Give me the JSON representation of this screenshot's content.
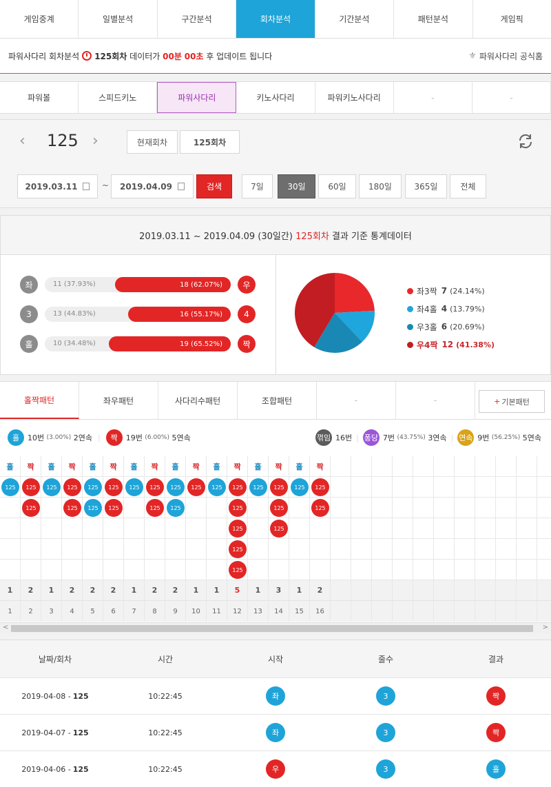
{
  "nav": [
    "게임중계",
    "일별분석",
    "구간분석",
    "회차분석",
    "기간분석",
    "패턴분석",
    "게임픽"
  ],
  "nav_active": 3,
  "info": {
    "prefix": "파워사다리 회차분석",
    "round": "125회차",
    "mid": "데이터가",
    "min": "00분",
    "sec": "00초",
    "suffix": "후 업데이트 됩니다",
    "homepage": "파워사다리 공식홈"
  },
  "game_tabs": [
    "파워볼",
    "스피드키노",
    "파워사다리",
    "키노사다리",
    "파워키노사다리",
    "-",
    "-"
  ],
  "game_tab_active": 2,
  "round_panel": {
    "round_number": "125",
    "current_label": "현재회차",
    "round_box": "125회차",
    "date_from": "2019.03.11",
    "date_to": "2019.04.09",
    "tilde": "~",
    "search": "검색",
    "ranges": [
      "7일",
      "30일",
      "60일",
      "180일",
      "365일",
      "전체"
    ],
    "range_active": 1
  },
  "stats": {
    "head_range": "2019.03.11 ~ 2019.04.09 (30일간)",
    "head_round": "125회차",
    "head_suffix": "결과 기준 통계데이터",
    "rows": [
      {
        "left_label": "좌",
        "left_val": "11 (37.93%)",
        "right_val": "18 (62.07%)",
        "right_label": "우",
        "right_pct": 62.07
      },
      {
        "left_label": "3",
        "left_val": "13 (44.83%)",
        "right_val": "16 (55.17%)",
        "right_label": "4",
        "right_pct": 55.17
      },
      {
        "left_label": "홀",
        "left_val": "10 (34.48%)",
        "right_val": "19 (65.52%)",
        "right_label": "짝",
        "right_pct": 65.52
      }
    ],
    "pie": [
      {
        "label": "좌3짝",
        "count": "7",
        "pct": "(24.14%)",
        "value": 24.14,
        "color": "#e8282b"
      },
      {
        "label": "좌4홀",
        "count": "4",
        "pct": "(13.79%)",
        "value": 13.79,
        "color": "#1fa6dc"
      },
      {
        "label": "우3홀",
        "count": "6",
        "pct": "(20.69%)",
        "value": 20.69,
        "color": "#1a88b4"
      },
      {
        "label": "우4짝",
        "count": "12",
        "pct": "(41.38%)",
        "value": 41.38,
        "color": "#c21d22"
      }
    ]
  },
  "pattern": {
    "tabs": [
      "홀짝패턴",
      "좌우패턴",
      "사다리수패턴",
      "조합패턴",
      "-",
      "-"
    ],
    "tab_active": 0,
    "basic_button": "기본패턴",
    "summary": {
      "odd_label": "홀",
      "odd_text": "10번",
      "odd_pct": "(3.00%)",
      "odd_streak": "2연속",
      "even_label": "짝",
      "even_text": "19번",
      "even_pct": "(6.00%)",
      "even_streak": "5연속",
      "break_label": "꺾임",
      "break_text": "16번",
      "pong_label": "퐁당",
      "pong_text": "7번",
      "pong_pct": "(43.75%)",
      "pong_streak": "3연속",
      "cont_label": "연속",
      "cont_text": "9번",
      "cont_pct": "(56.25%)",
      "cont_streak": "5연속"
    },
    "columns": [
      {
        "head": "홀",
        "type": "blue",
        "count": 1
      },
      {
        "head": "짝",
        "type": "red",
        "count": 2
      },
      {
        "head": "홀",
        "type": "blue",
        "count": 1
      },
      {
        "head": "짝",
        "type": "red",
        "count": 2
      },
      {
        "head": "홀",
        "type": "blue",
        "count": 2
      },
      {
        "head": "짝",
        "type": "red",
        "count": 2
      },
      {
        "head": "홀",
        "type": "blue",
        "count": 1
      },
      {
        "head": "짝",
        "type": "red",
        "count": 2
      },
      {
        "head": "홀",
        "type": "blue",
        "count": 2
      },
      {
        "head": "짝",
        "type": "red",
        "count": 1
      },
      {
        "head": "홀",
        "type": "blue",
        "count": 1
      },
      {
        "head": "짝",
        "type": "red",
        "count": 5
      },
      {
        "head": "홀",
        "type": "blue",
        "count": 1
      },
      {
        "head": "짝",
        "type": "red",
        "count": 3
      },
      {
        "head": "홀",
        "type": "blue",
        "count": 1
      },
      {
        "head": "짝",
        "type": "red",
        "count": 2
      }
    ],
    "ball_label": "125",
    "count_row": [
      "1",
      "2",
      "1",
      "2",
      "2",
      "2",
      "1",
      "2",
      "2",
      "1",
      "1",
      "5",
      "1",
      "3",
      "1",
      "2"
    ],
    "index_row": [
      "1",
      "2",
      "3",
      "4",
      "5",
      "6",
      "7",
      "8",
      "9",
      "10",
      "11",
      "12",
      "13",
      "14",
      "15",
      "16"
    ],
    "highlight_index": 11,
    "scroll_left": "<",
    "scroll_right": ">"
  },
  "results": {
    "headers": [
      "날짜/회차",
      "시간",
      "시작",
      "줄수",
      "결과"
    ],
    "rows": [
      {
        "date": "2019-04-08 -",
        "round": "125",
        "time": "10:22:45",
        "start": "좌",
        "start_type": "blue",
        "lines": "3",
        "lines_type": "blue",
        "result": "짝",
        "result_type": "red"
      },
      {
        "date": "2019-04-07 -",
        "round": "125",
        "time": "10:22:45",
        "start": "좌",
        "start_type": "blue",
        "lines": "3",
        "lines_type": "blue",
        "result": "짝",
        "result_type": "red"
      },
      {
        "date": "2019-04-06 -",
        "round": "125",
        "time": "10:22:45",
        "start": "우",
        "start_type": "red",
        "lines": "3",
        "lines_type": "blue",
        "result": "홀",
        "result_type": "blue"
      }
    ]
  }
}
